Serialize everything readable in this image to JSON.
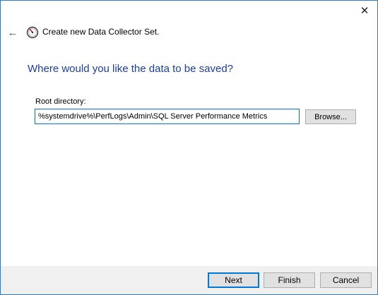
{
  "window": {
    "close_glyph": "✕"
  },
  "header": {
    "back_glyph": "←",
    "icon": "performance-monitor-icon",
    "title": "Create new Data Collector Set."
  },
  "main": {
    "question": "Where would you like the data to be saved?",
    "root_label": "Root directory:",
    "root_value": "%systemdrive%\\PerfLogs\\Admin\\SQL Server Performance Metrics",
    "browse_label": "Browse..."
  },
  "footer": {
    "next_label": "Next",
    "finish_label": "Finish",
    "cancel_label": "Cancel"
  },
  "colors": {
    "accent": "#0078d7",
    "question_text": "#1b3da7",
    "footer_bg": "#f0f0f0"
  }
}
